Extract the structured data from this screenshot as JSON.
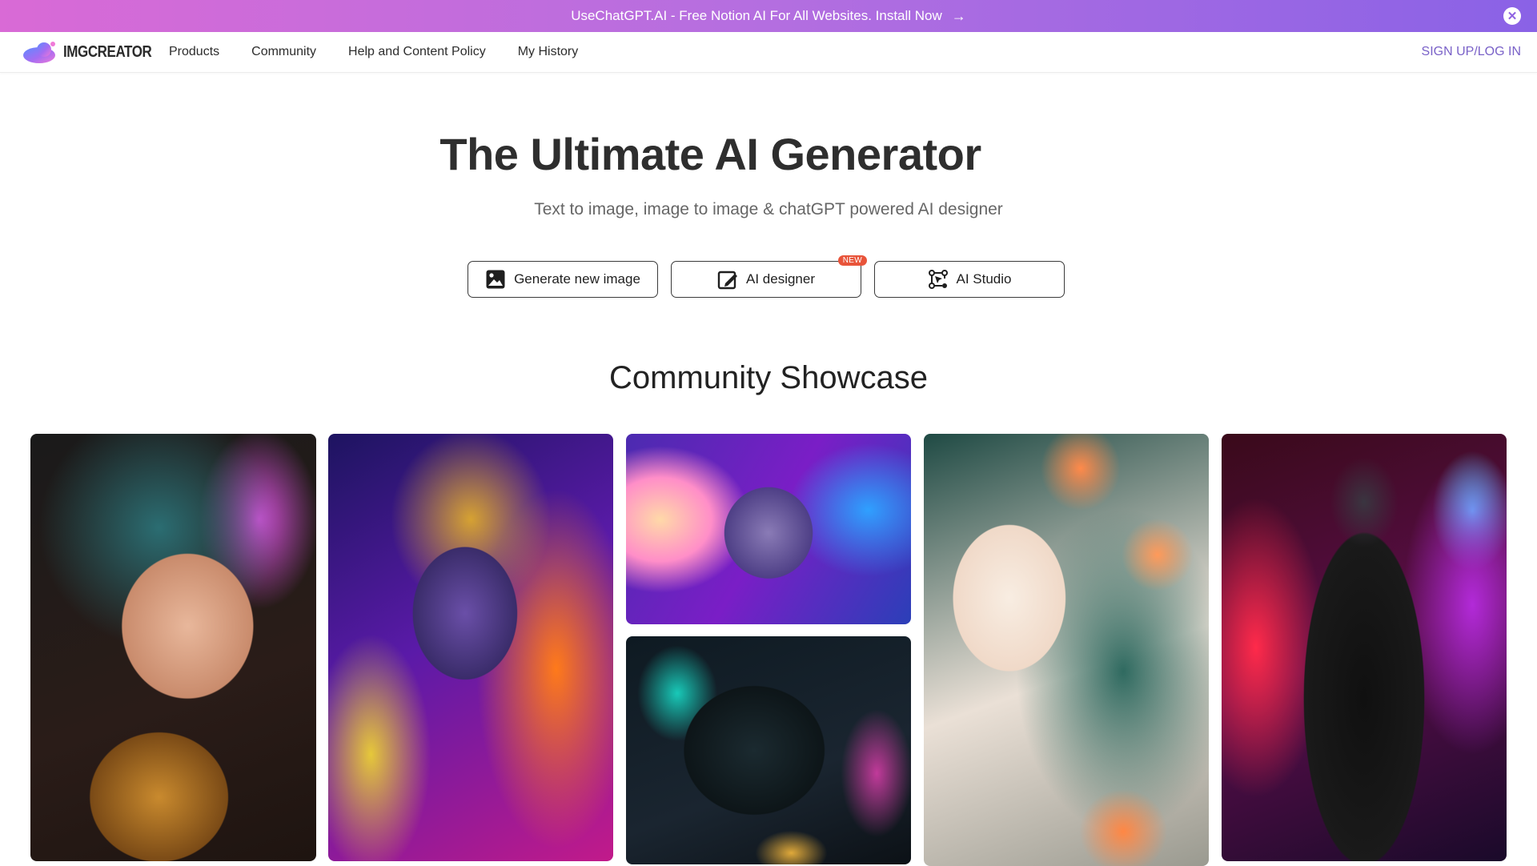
{
  "promo": {
    "text": "UseChatGPT.AI - Free Notion AI For All Websites. Install Now",
    "arrow_icon": "arrow-right-icon",
    "close_icon": "close-icon"
  },
  "nav": {
    "logo_text": "IMGCREATOR",
    "links": [
      "Products",
      "Community",
      "Help and Content Policy",
      "My History"
    ],
    "signin": "SIGN UP/LOG IN"
  },
  "hero": {
    "title": "The Ultimate AI Generator",
    "subtitle": "Text to image, image to image & chatGPT powered AI designer"
  },
  "ctas": [
    {
      "label": "Generate new image",
      "icon": "image-icon"
    },
    {
      "label": "AI designer",
      "icon": "designer-icon",
      "badge": "NEW"
    },
    {
      "label": "AI Studio",
      "icon": "studio-icon"
    }
  ],
  "showcase": {
    "title": "Community Showcase"
  },
  "colors": {
    "banner_start": "#d96ad6",
    "banner_end": "#8a62e6",
    "signin": "#7a62c8",
    "badge": "#e8543a"
  }
}
